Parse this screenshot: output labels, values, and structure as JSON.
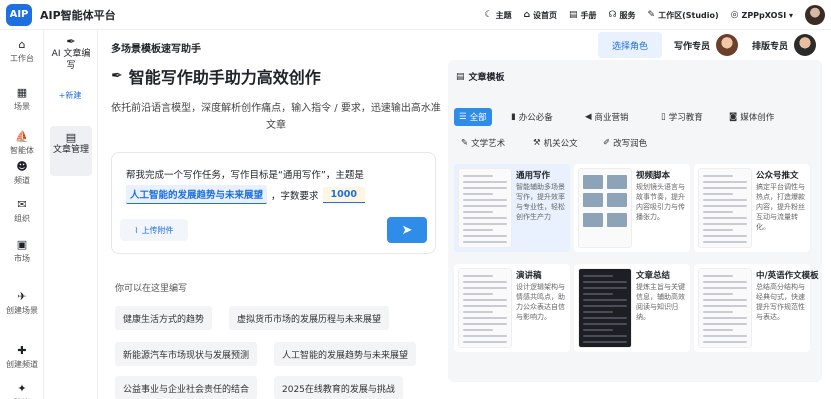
{
  "app": {
    "logo_text": "AIP",
    "title": "AIP智能体平台",
    "accent": "#1e6fe0"
  },
  "topnav": [
    {
      "icon": "moon-icon",
      "glyph": "☾",
      "label": "主题"
    },
    {
      "icon": "home-icon",
      "glyph": "⌂",
      "label": "设首页"
    },
    {
      "icon": "book-icon",
      "glyph": "▤",
      "label": "手册"
    },
    {
      "icon": "headset-icon",
      "glyph": "☊",
      "label": "服务"
    },
    {
      "icon": "pen-icon",
      "glyph": "✎",
      "label": "工作区(Studio)"
    },
    {
      "icon": "globe-icon",
      "glyph": "◎",
      "label": "ZPPpXOSI ▾"
    }
  ],
  "sidebar": [
    {
      "icon": "workbench-icon",
      "glyph": "⌂",
      "label": "工作台"
    },
    {
      "icon": "scene-icon",
      "glyph": "▦",
      "label": "场景"
    },
    {
      "icon": "agent-icon",
      "glyph": "⛵",
      "label": "智能体"
    },
    {
      "icon": "channel-icon",
      "glyph": "☻",
      "label": "频道"
    },
    {
      "icon": "org-icon",
      "glyph": "✉",
      "label": "组织"
    },
    {
      "icon": "market-icon",
      "glyph": "▣",
      "label": "市场"
    },
    {
      "icon": "create-scene-icon",
      "glyph": "✈",
      "label": "创建场景"
    },
    {
      "icon": "create-channel-icon",
      "glyph": "✚",
      "label": "创建频道"
    },
    {
      "icon": "suggest-icon",
      "glyph": "✦",
      "label": "建议"
    }
  ],
  "subbar": {
    "ai_label": "AI 文章编写",
    "new_label": "+新建",
    "doc_label": "文章管理"
  },
  "main": {
    "page_title": "多场景模板速写助手",
    "select_role": "选择角色",
    "experts": [
      "写作专员",
      "排版专员"
    ],
    "hero": "智能写作助手助力高效创作",
    "subtitle": "依托前沿语言模型，深度解析创作痛点，输入指令 / 要求，迅速输出高水准文章",
    "prompt": {
      "line1": "帮我完成一个写作任务，写作目标是“通用写作”，主题是",
      "topic": "人工智能的发展趋势与未来展望",
      "mid": "，字数要求",
      "count": "1000",
      "upload": "上传附件"
    },
    "hint": "你可以在这里编写",
    "suggestions": [
      "健康生活方式的趋势",
      "虚拟货币市场的发展历程与未来展望",
      "新能源汽车市场现状与发展预测",
      "人工智能的发展趋势与未来展望",
      "公益事业与企业社会责任的结合",
      "2025在线教育的发展与挑战"
    ]
  },
  "templates": {
    "title": "文章模板",
    "tabs": [
      {
        "icon": "list-icon",
        "glyph": "☰",
        "label": "全部",
        "active": true
      },
      {
        "icon": "office-icon",
        "glyph": "▮",
        "label": "办公必备"
      },
      {
        "icon": "megaphone-icon",
        "glyph": "◀",
        "label": "商业营销"
      },
      {
        "icon": "study-icon",
        "glyph": "▯",
        "label": "学习教育"
      },
      {
        "icon": "camera-icon",
        "glyph": "◙",
        "label": "媒体创作"
      },
      {
        "icon": "brush-icon",
        "glyph": "✎",
        "label": "文学艺术"
      },
      {
        "icon": "gavel-icon",
        "glyph": "⚒",
        "label": "机关公文"
      },
      {
        "icon": "pencil-icon",
        "glyph": "✐",
        "label": "改写润色"
      }
    ],
    "cards": [
      {
        "title": "通用写作",
        "desc": "智能辅助多场景写作，提升效率与专业性，轻松创作生产力",
        "style": "doc"
      },
      {
        "title": "视频脚本",
        "desc": "规划镜头语言与故事节奏，提升内容吸引力与传播张力。",
        "style": "img"
      },
      {
        "title": "公众号推文",
        "desc": "搞定平台调性与热点，打造爆款内容，提升粉丝互动与流量转化。",
        "style": "doc"
      },
      {
        "title": "演讲稿",
        "desc": "设计逻辑架构与情感共鸣点，助力公众表达自信与影响力。",
        "style": "doc"
      },
      {
        "title": "文章总结",
        "desc": "提炼主旨与关键信息，辅助高效阅读与知识归纳。",
        "style": "dark"
      },
      {
        "title": "中/英语作文模板",
        "desc": "总结高分结构与经典句式，快速提升写作规范性与表达。",
        "style": "doc"
      }
    ]
  }
}
